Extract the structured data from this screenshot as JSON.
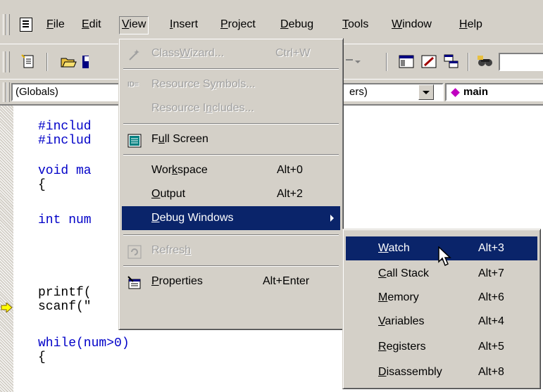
{
  "menubar": {
    "items": [
      {
        "key": "F",
        "rest": "ile"
      },
      {
        "key": "E",
        "rest": "dit"
      },
      {
        "key": "V",
        "rest": "iew"
      },
      {
        "key": "I",
        "rest": "nsert"
      },
      {
        "key": "P",
        "rest": "roject"
      },
      {
        "key": "D",
        "rest": "ebug"
      },
      {
        "key": "T",
        "rest": "ools"
      },
      {
        "key": "W",
        "rest": "indow"
      },
      {
        "key": "H",
        "rest": "elp"
      }
    ]
  },
  "wizardbar": {
    "globals": "(Globals)",
    "members_suffix": "ers)",
    "function": "main"
  },
  "editor": {
    "lines": [
      "#includ",
      "#includ",
      "",
      "void ma",
      "{",
      "",
      "int num",
      "",
      "",
      "",
      "printf(",
      "scanf(\"",
      "",
      "while(num>0)",
      "{"
    ]
  },
  "view_menu": {
    "classwizard": {
      "pre": "Class",
      "key": "W",
      "post": "izard...",
      "shortcut": "Ctrl+W"
    },
    "resource_symbols": {
      "pre": "Resource S",
      "key": "y",
      "post": "mbols..."
    },
    "resource_includes": {
      "pre": "Resource I",
      "key": "n",
      "post": "cludes..."
    },
    "full_screen": {
      "pre": "F",
      "key": "u",
      "post": "ll Screen"
    },
    "workspace": {
      "pre": "Wor",
      "key": "k",
      "post": "space",
      "shortcut": "Alt+0"
    },
    "output": {
      "pre": "",
      "key": "O",
      "post": "utput",
      "shortcut": "Alt+2"
    },
    "debug_windows": {
      "pre": "",
      "key": "D",
      "post": "ebug Windows"
    },
    "refresh": {
      "pre": "Refres",
      "key": "h",
      "post": ""
    },
    "properties": {
      "pre": "",
      "key": "P",
      "post": "roperties",
      "shortcut": "Alt+Enter"
    }
  },
  "debug_submenu": {
    "watch": {
      "pre": "",
      "key": "W",
      "post": "atch",
      "shortcut": "Alt+3"
    },
    "call_stack": {
      "pre": "",
      "key": "C",
      "post": "all Stack",
      "shortcut": "Alt+7"
    },
    "memory": {
      "pre": "",
      "key": "M",
      "post": "emory",
      "shortcut": "Alt+6"
    },
    "variables": {
      "pre": "",
      "key": "V",
      "post": "ariables",
      "shortcut": "Alt+4"
    },
    "registers": {
      "pre": "",
      "key": "R",
      "post": "egisters",
      "shortcut": "Alt+5"
    },
    "disassembly": {
      "pre": "",
      "key": "D",
      "post": "isassembly",
      "shortcut": "Alt+8"
    }
  },
  "colors": {
    "highlight": "#0a246a",
    "menu_face": "#d4d0c8",
    "keyword": "#0000c8"
  }
}
